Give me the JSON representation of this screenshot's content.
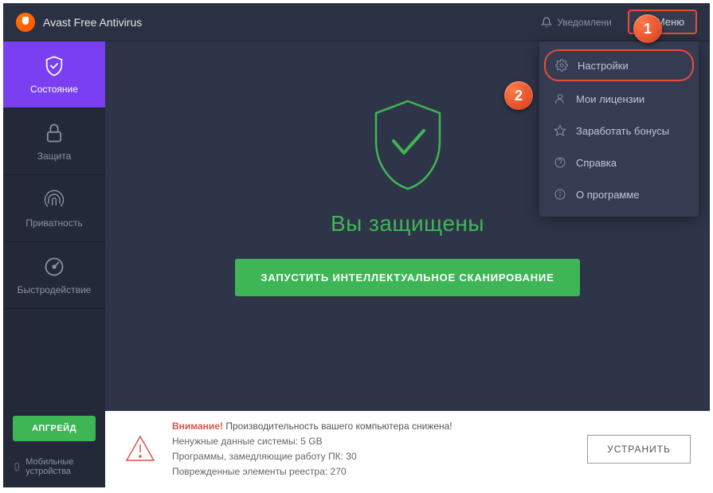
{
  "brand": {
    "title": "Avast Free Antivirus"
  },
  "topbar": {
    "notifications": "Уведомлени",
    "menu": "Меню"
  },
  "sidebar": {
    "items": [
      {
        "label": "Состояние"
      },
      {
        "label": "Защита"
      },
      {
        "label": "Приватность"
      },
      {
        "label": "Быстродействие"
      }
    ],
    "upgrade": "АПГРЕЙД",
    "mobile": "Мобильные устройства"
  },
  "main": {
    "status_title": "Вы защищены",
    "scan_button": "ЗАПУСТИТЬ ИНТЕЛЛЕКТУАЛЬНОЕ СКАНИРОВАНИЕ"
  },
  "dropdown": {
    "items": [
      {
        "label": "Настройки"
      },
      {
        "label": "Мои лицензии"
      },
      {
        "label": "Заработать бонусы"
      },
      {
        "label": "Справка"
      },
      {
        "label": "О программе"
      }
    ]
  },
  "banner": {
    "warning_prefix": "Внимание!",
    "warning_text": " Производительность вашего компьютера снижена!",
    "line1": "Ненужные данные системы: 5 GB",
    "line2": "Программы, замедляющие работу ПК: 30",
    "line3": "Поврежденные элементы реестра: 270",
    "fix": "УСТРАНИТЬ"
  },
  "callouts": {
    "c1": "1",
    "c2": "2"
  }
}
